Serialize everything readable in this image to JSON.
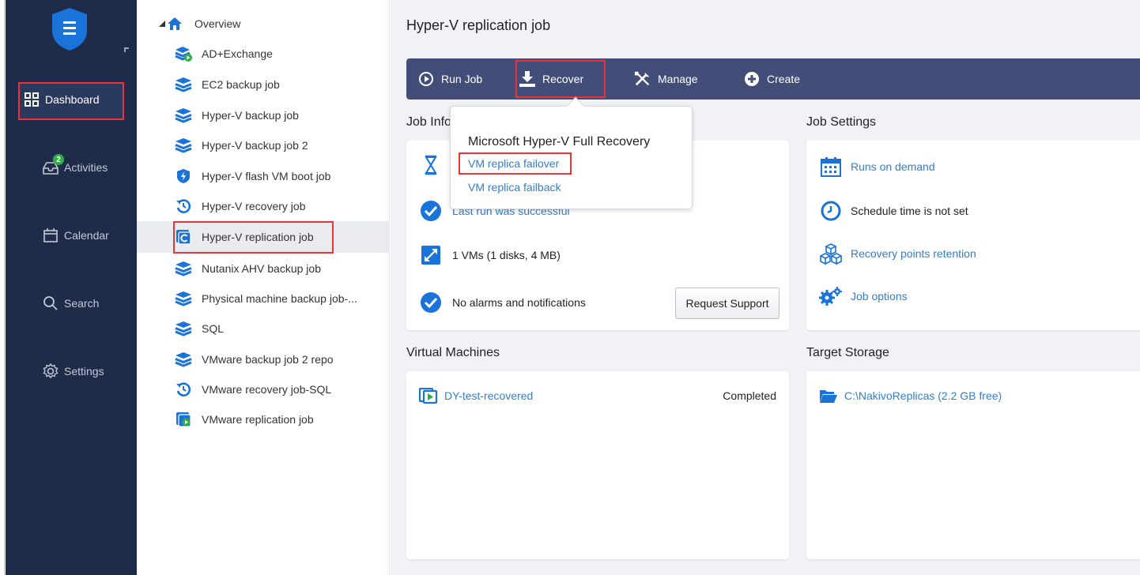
{
  "sidebar": {
    "items": [
      {
        "label": "Dashboard",
        "icon": "dashboard-grid-icon"
      },
      {
        "label": "Activities",
        "icon": "inbox-icon",
        "badge": "2"
      },
      {
        "label": "Calendar",
        "icon": "calendar-icon"
      },
      {
        "label": "Search",
        "icon": "search-icon"
      },
      {
        "label": "Settings",
        "icon": "gear-icon"
      }
    ]
  },
  "tree": {
    "root": "Overview",
    "items": [
      {
        "label": "AD+Exchange",
        "icon": "backup-running-icon"
      },
      {
        "label": "EC2 backup job",
        "icon": "backup-job-icon"
      },
      {
        "label": "Hyper-V backup job",
        "icon": "backup-job-icon"
      },
      {
        "label": "Hyper-V backup job 2",
        "icon": "backup-job-icon"
      },
      {
        "label": "Hyper-V flash VM boot job",
        "icon": "flash-boot-icon"
      },
      {
        "label": "Hyper-V recovery job",
        "icon": "recovery-job-icon"
      },
      {
        "label": "Hyper-V replication job",
        "icon": "replication-job-icon"
      },
      {
        "label": "Nutanix AHV backup job",
        "icon": "backup-job-icon"
      },
      {
        "label": "Physical machine backup job-...",
        "icon": "backup-job-icon"
      },
      {
        "label": "SQL",
        "icon": "backup-job-icon"
      },
      {
        "label": "VMware backup job 2 repo",
        "icon": "backup-job-icon"
      },
      {
        "label": "VMware recovery job-SQL",
        "icon": "recovery-job-icon"
      },
      {
        "label": "VMware replication job",
        "icon": "replication-running-icon"
      }
    ]
  },
  "main": {
    "title": "Hyper-V replication job",
    "toolbar": {
      "run": "Run Job",
      "recover": "Recover",
      "manage": "Manage",
      "create": "Create"
    },
    "job_info": {
      "title": "Job Info",
      "last_run": "Last run was successful",
      "vms": "1 VMs (1 disks, 4 MB)",
      "alarms": "No alarms and notifications",
      "request_support": "Request Support"
    },
    "job_settings": {
      "title": "Job Settings",
      "runs": "Runs on demand",
      "schedule": "Schedule time is not set",
      "retention": "Recovery points retention",
      "options": "Job options"
    },
    "virtual_machines": {
      "title": "Virtual Machines",
      "rows": [
        {
          "name": "DY-test-recovered",
          "status": "Completed"
        }
      ]
    },
    "target_storage": {
      "title": "Target Storage",
      "path": "C:\\NakivoReplicas (2.2 GB free)"
    }
  },
  "popup": {
    "title": "Microsoft Hyper-V Full Recovery",
    "items": [
      "VM replica failover",
      "VM replica failback"
    ]
  },
  "colors": {
    "sidebar_bg": "#1e2b49",
    "toolbar_bg": "#434e78",
    "link": "#2f7fd1",
    "highlight": "#e8343a",
    "accent_blue": "#1a73d9"
  }
}
